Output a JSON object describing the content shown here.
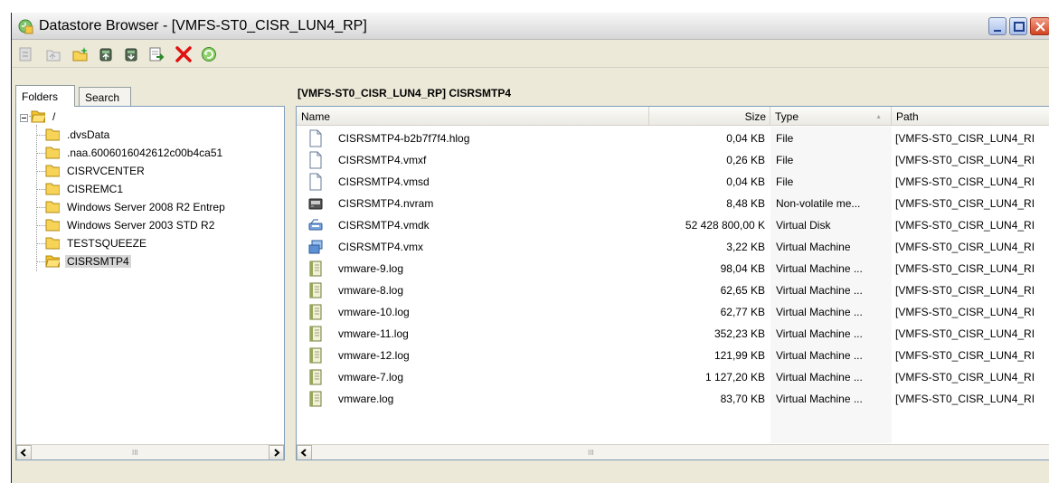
{
  "window": {
    "title": "Datastore Browser - [VMFS-ST0_CISR_LUN4_RP]"
  },
  "toolbar": {
    "buttons": [
      {
        "icon": "browse-datastore-icon",
        "enabled": false
      },
      {
        "icon": "parent-folder-icon",
        "enabled": false
      },
      {
        "icon": "new-folder-icon",
        "enabled": true
      },
      {
        "icon": "upload-icon",
        "enabled": true
      },
      {
        "icon": "download-icon",
        "enabled": true
      },
      {
        "icon": "add-inventory-icon",
        "enabled": true
      },
      {
        "icon": "delete-icon",
        "enabled": true
      },
      {
        "icon": "refresh-icon",
        "enabled": true
      }
    ]
  },
  "left": {
    "tabs": [
      {
        "label": "Folders",
        "active": true
      },
      {
        "label": "Search",
        "active": false
      }
    ],
    "tree": {
      "root": "/",
      "items": [
        {
          "label": ".dvsData"
        },
        {
          "label": ".naa.6006016042612c00b4ca51"
        },
        {
          "label": "CISRVCENTER"
        },
        {
          "label": "CISREMC1"
        },
        {
          "label": "Windows Server 2008 R2 Entrep"
        },
        {
          "label": "Windows Server 2003 STD R2"
        },
        {
          "label": "TESTSQUEEZE"
        },
        {
          "label": "CISRSMTP4",
          "selected": true
        }
      ]
    },
    "scroll_grip": "III"
  },
  "right": {
    "path": "[VMFS-ST0_CISR_LUN4_RP] CISRSMTP4",
    "columns": {
      "name": "Name",
      "size": "Size",
      "type": "Type",
      "path": "Path"
    },
    "files": [
      {
        "icon": "file-icon",
        "name": "CISRSMTP4-b2b7f7f4.hlog",
        "size": "0,04 KB",
        "type": "File",
        "path": "[VMFS-ST0_CISR_LUN4_RI"
      },
      {
        "icon": "file-icon",
        "name": "CISRSMTP4.vmxf",
        "size": "0,26 KB",
        "type": "File",
        "path": "[VMFS-ST0_CISR_LUN4_RI"
      },
      {
        "icon": "file-icon",
        "name": "CISRSMTP4.vmsd",
        "size": "0,04 KB",
        "type": "File",
        "path": "[VMFS-ST0_CISR_LUN4_RI"
      },
      {
        "icon": "nvram-icon",
        "name": "CISRSMTP4.nvram",
        "size": "8,48 KB",
        "type": "Non-volatile me...",
        "path": "[VMFS-ST0_CISR_LUN4_RI"
      },
      {
        "icon": "virtual-disk-icon",
        "name": "CISRSMTP4.vmdk",
        "size": "52 428 800,00 K",
        "type": "Virtual Disk",
        "path": "[VMFS-ST0_CISR_LUN4_RI"
      },
      {
        "icon": "virtual-machine-icon",
        "name": "CISRSMTP4.vmx",
        "size": "3,22 KB",
        "type": "Virtual Machine",
        "path": "[VMFS-ST0_CISR_LUN4_RI"
      },
      {
        "icon": "log-icon",
        "name": "vmware-9.log",
        "size": "98,04 KB",
        "type": "Virtual Machine ...",
        "path": "[VMFS-ST0_CISR_LUN4_RI"
      },
      {
        "icon": "log-icon",
        "name": "vmware-8.log",
        "size": "62,65 KB",
        "type": "Virtual Machine ...",
        "path": "[VMFS-ST0_CISR_LUN4_RI"
      },
      {
        "icon": "log-icon",
        "name": "vmware-10.log",
        "size": "62,77 KB",
        "type": "Virtual Machine ...",
        "path": "[VMFS-ST0_CISR_LUN4_RI"
      },
      {
        "icon": "log-icon",
        "name": "vmware-11.log",
        "size": "352,23 KB",
        "type": "Virtual Machine ...",
        "path": "[VMFS-ST0_CISR_LUN4_RI"
      },
      {
        "icon": "log-icon",
        "name": "vmware-12.log",
        "size": "121,99 KB",
        "type": "Virtual Machine ...",
        "path": "[VMFS-ST0_CISR_LUN4_RI"
      },
      {
        "icon": "log-icon",
        "name": "vmware-7.log",
        "size": "1 127,20 KB",
        "type": "Virtual Machine ...",
        "path": "[VMFS-ST0_CISR_LUN4_RI"
      },
      {
        "icon": "log-icon",
        "name": "vmware.log",
        "size": "83,70 KB",
        "type": "Virtual Machine ...",
        "path": "[VMFS-ST0_CISR_LUN4_RI"
      }
    ],
    "scroll_grip": "III"
  }
}
